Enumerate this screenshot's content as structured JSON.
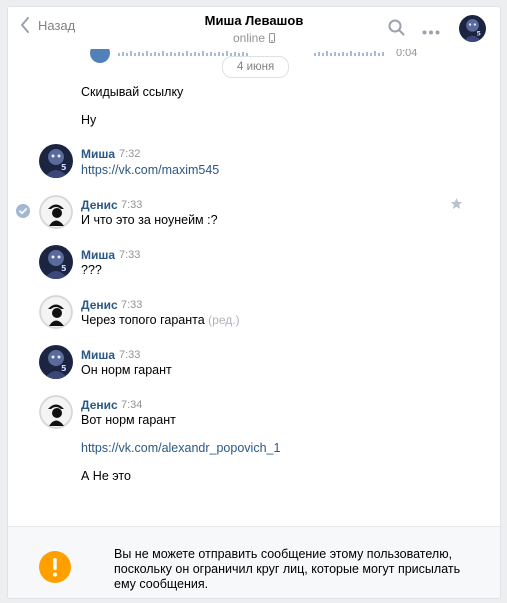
{
  "header": {
    "back_label": "Назад",
    "name": "Миша Левашов",
    "status": "online"
  },
  "voice": {
    "duration": "0:04"
  },
  "date_divider": "4 июня",
  "messages": [
    {
      "author": "",
      "time": "",
      "text": "Скидывай ссылку"
    },
    {
      "author": "",
      "time": "",
      "text": "Ну"
    },
    {
      "author": "Миша",
      "time": "7:32",
      "text": "https://vk.com/maxim545"
    },
    {
      "author": "Денис",
      "time": "7:33",
      "text": "И что это за ноунейм :?"
    },
    {
      "author": "Миша",
      "time": "7:33",
      "text": "???"
    },
    {
      "author": "Денис",
      "time": "7:33",
      "text": "Через топого гаранта",
      "edited": "(ред.)"
    },
    {
      "author": "Миша",
      "time": "7:33",
      "text": "Он норм гарант"
    },
    {
      "author": "Денис",
      "time": "7:34",
      "text": "Вот норм гарант"
    },
    {
      "author": "",
      "time": "",
      "text": "https://vk.com/alexandr_popovich_1"
    },
    {
      "author": "",
      "time": "",
      "text": "А Не это"
    }
  ],
  "footer": {
    "notice": "Вы не можете отправить сообщение этому пользователю, поскольку он ограничил круг лиц, которые могут присылать ему сообщения."
  },
  "colors": {
    "accent": "#2a5885",
    "voice_play": "#5181b8",
    "warning": "#ffa000",
    "muted": "#939393"
  }
}
